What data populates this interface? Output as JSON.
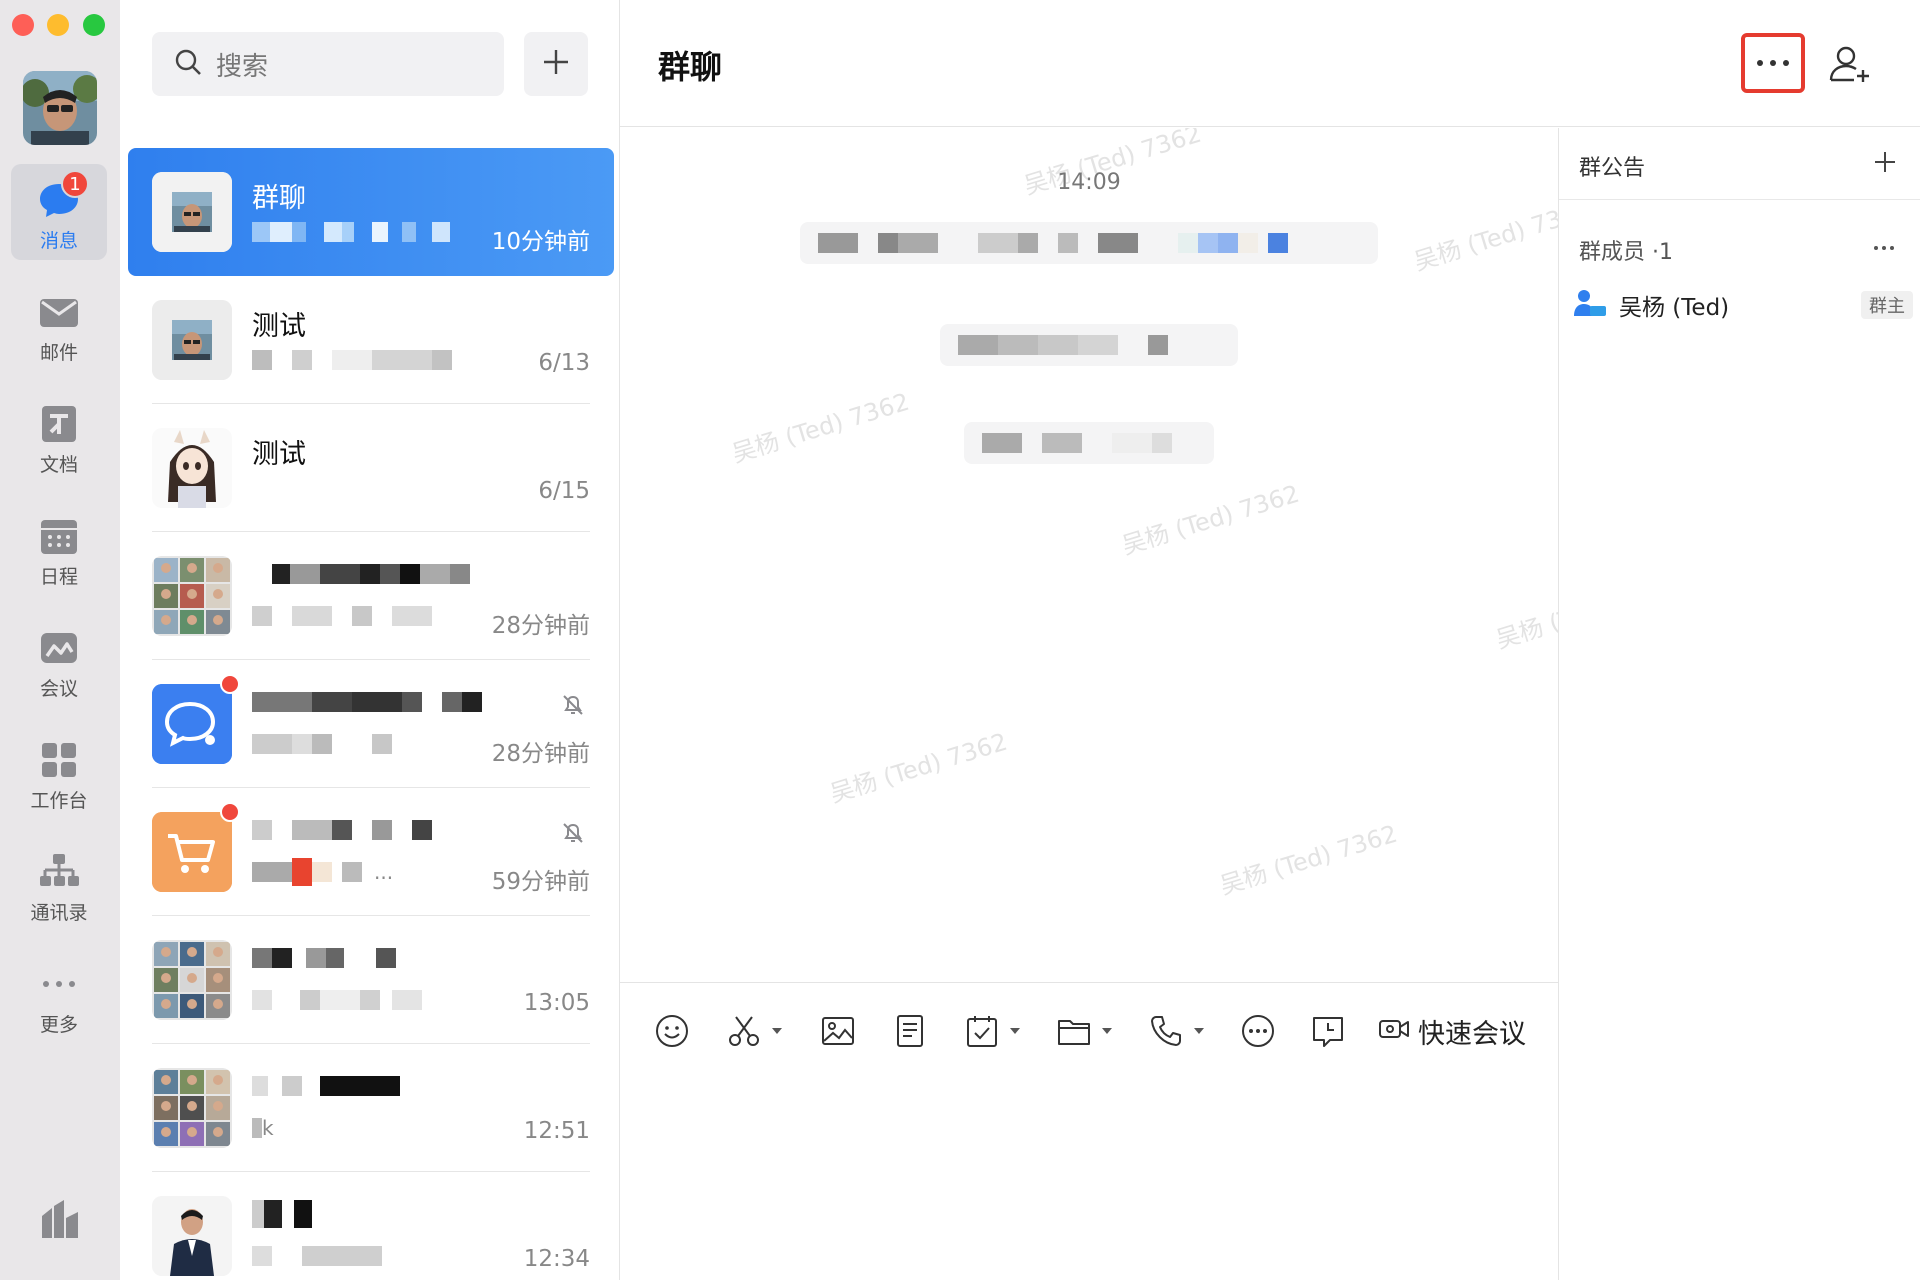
{
  "sidebar": {
    "unread_badge": "1",
    "items": [
      {
        "label": "消息",
        "icon": "message-icon"
      },
      {
        "label": "邮件",
        "icon": "mail-icon"
      },
      {
        "label": "文档",
        "icon": "document-icon"
      },
      {
        "label": "日程",
        "icon": "calendar-icon"
      },
      {
        "label": "会议",
        "icon": "meeting-icon"
      },
      {
        "label": "工作台",
        "icon": "workbench-icon"
      },
      {
        "label": "通讯录",
        "icon": "contacts-icon"
      },
      {
        "label": "更多",
        "icon": "more-icon"
      }
    ]
  },
  "search": {
    "placeholder": "搜索"
  },
  "conversations": [
    {
      "name": "群聊",
      "time": "10分钟前",
      "active": true
    },
    {
      "name": "测试",
      "time": "6/13"
    },
    {
      "name": "测试",
      "time": "6/15"
    },
    {
      "name": "",
      "time": "28分钟前"
    },
    {
      "name": "",
      "time": "28分钟前",
      "unread_dot": true,
      "muted": true
    },
    {
      "name": "",
      "time": "59分钟前",
      "unread_dot": true,
      "muted": true,
      "preview_ellipsis": "..."
    },
    {
      "name": "",
      "time": "13:05"
    },
    {
      "name": "",
      "time": "12:51",
      "preview_char": "k"
    },
    {
      "name": "",
      "time": "12:34"
    }
  ],
  "chat": {
    "title": "群聊",
    "timestamp": "14:09",
    "watermark": "吴杨 (Ted) 7362",
    "toolbar": {
      "quick_meeting": "快速会议"
    }
  },
  "panel": {
    "notice_label": "群公告",
    "members_label": "群成员",
    "members_count": "·1",
    "member": {
      "name": "吴杨 (Ted)",
      "role": "群主"
    }
  },
  "colors": {
    "accent": "#2f7fee",
    "badge": "#f0473c",
    "highlight_border": "#e53b2f"
  }
}
